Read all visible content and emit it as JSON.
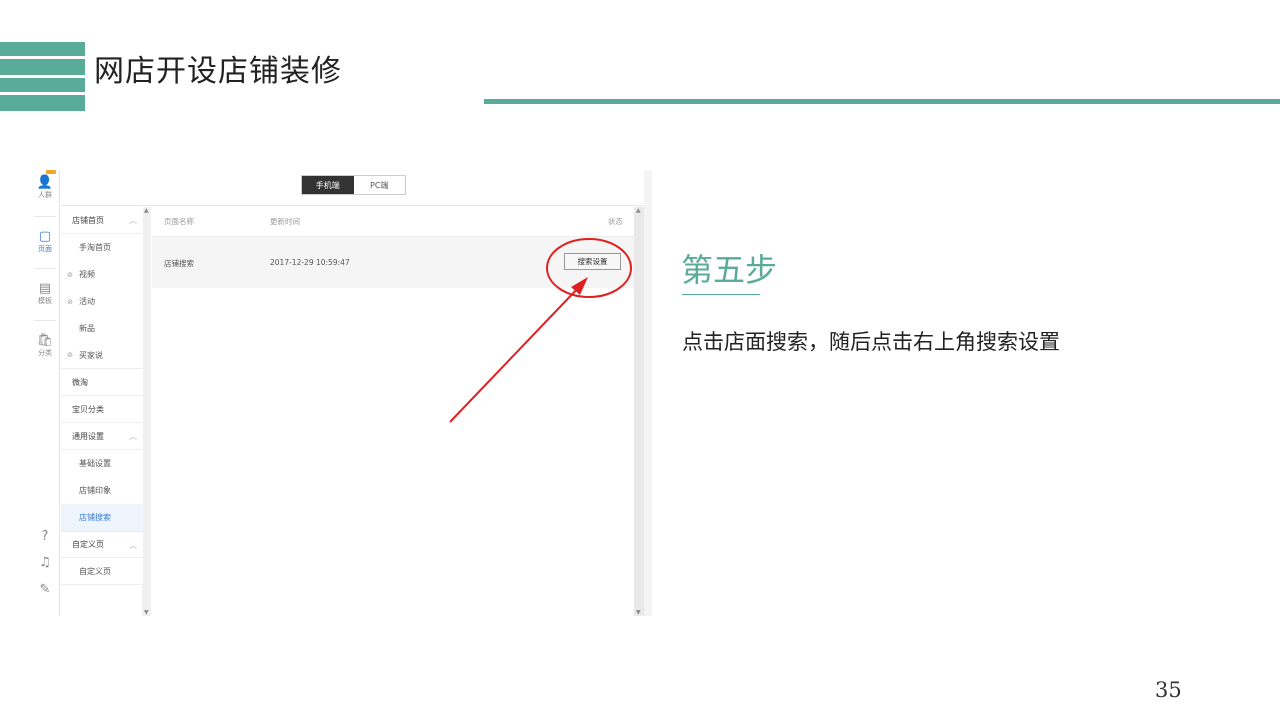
{
  "slide": {
    "title": "网店开设店铺装修",
    "step_title": "第五步",
    "step_desc": "点击店面搜索，随后点击右上角搜索设置",
    "page_number": "35",
    "accent_color": "#5aac9a"
  },
  "iconbar": {
    "items": [
      {
        "icon": "user-icon",
        "glyph": "👤",
        "label": "人群"
      },
      {
        "icon": "page-icon",
        "glyph": "▢",
        "label": "页面"
      },
      {
        "icon": "template-icon",
        "glyph": "▤",
        "label": "模板"
      },
      {
        "icon": "bag-icon",
        "glyph": "🛍",
        "label": "分类"
      }
    ],
    "bottom_icons": [
      {
        "icon": "help-icon",
        "glyph": "?"
      },
      {
        "icon": "headset-icon",
        "glyph": "♫"
      },
      {
        "icon": "edit-icon",
        "glyph": "✎"
      }
    ]
  },
  "tabs": [
    {
      "label": "手机端",
      "active": true
    },
    {
      "label": "PC端",
      "active": false
    }
  ],
  "nav": {
    "items": [
      {
        "label": "店铺首页",
        "type": "group",
        "caret": "︿"
      },
      {
        "label": "手淘首页",
        "type": "sub",
        "prefix": ""
      },
      {
        "label": "视频",
        "type": "sub",
        "prefix": "⊘"
      },
      {
        "label": "活动",
        "type": "sub",
        "prefix": "⊘"
      },
      {
        "label": "新品",
        "type": "sub",
        "prefix": ""
      },
      {
        "label": "买家说",
        "type": "sub",
        "prefix": "⊘"
      },
      {
        "label": "微淘",
        "type": "group",
        "caret": ""
      },
      {
        "label": "宝贝分类",
        "type": "group",
        "caret": ""
      },
      {
        "label": "通用设置",
        "type": "group",
        "caret": "︿"
      },
      {
        "label": "基础设置",
        "type": "sub",
        "prefix": ""
      },
      {
        "label": "店铺印象",
        "type": "sub",
        "prefix": ""
      },
      {
        "label": "店铺搜索",
        "type": "sub",
        "prefix": "",
        "selected": true
      },
      {
        "label": "自定义页",
        "type": "group",
        "caret": "︿"
      },
      {
        "label": "自定义页",
        "type": "sub",
        "prefix": ""
      }
    ]
  },
  "table": {
    "headers": [
      "页面名称",
      "更新时间",
      "状态"
    ],
    "rows": [
      {
        "name": "店铺搜索",
        "updated": "2017-12-29 10:59:47",
        "action": "搜索设置"
      }
    ]
  },
  "annotation": {
    "color": "#e02020",
    "kind": "circle-and-arrow"
  }
}
